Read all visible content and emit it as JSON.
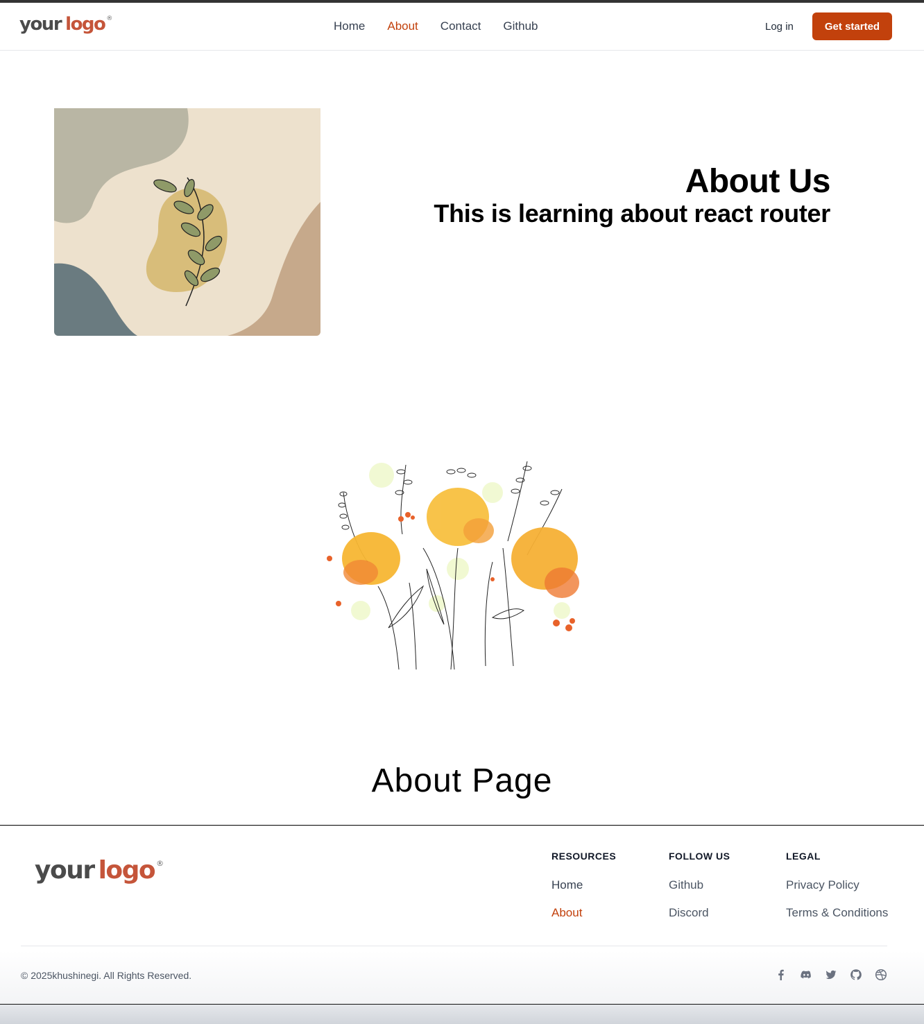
{
  "header": {
    "logo": {
      "word1": "your",
      "word2": "logo",
      "mark": "®"
    },
    "nav": [
      {
        "label": "Home",
        "active": false
      },
      {
        "label": "About",
        "active": true
      },
      {
        "label": "Contact",
        "active": false
      },
      {
        "label": "Github",
        "active": false
      }
    ],
    "login_label": "Log in",
    "cta_label": "Get started"
  },
  "hero": {
    "title": "About Us",
    "subtitle": "This is learning about react router"
  },
  "page_title": "About Page",
  "footer": {
    "logo": {
      "word1": "your",
      "word2": "logo",
      "mark": "®"
    },
    "columns": [
      {
        "heading": "RESOURCES",
        "links": [
          "Home",
          "About"
        ]
      },
      {
        "heading": "FOLLOW US",
        "links": [
          "Github",
          "Discord"
        ]
      },
      {
        "heading": "LEGAL",
        "links": [
          "Privacy Policy",
          "Terms & Conditions"
        ]
      }
    ],
    "copyright": "© 2025khushinegi. All Rights Reserved.",
    "socials": [
      "facebook-icon",
      "discord-icon",
      "twitter-icon",
      "github-icon",
      "dribbble-icon"
    ]
  },
  "colors": {
    "accent": "#c2410c",
    "logo_accent": "#c5553a",
    "text": "#374151"
  }
}
